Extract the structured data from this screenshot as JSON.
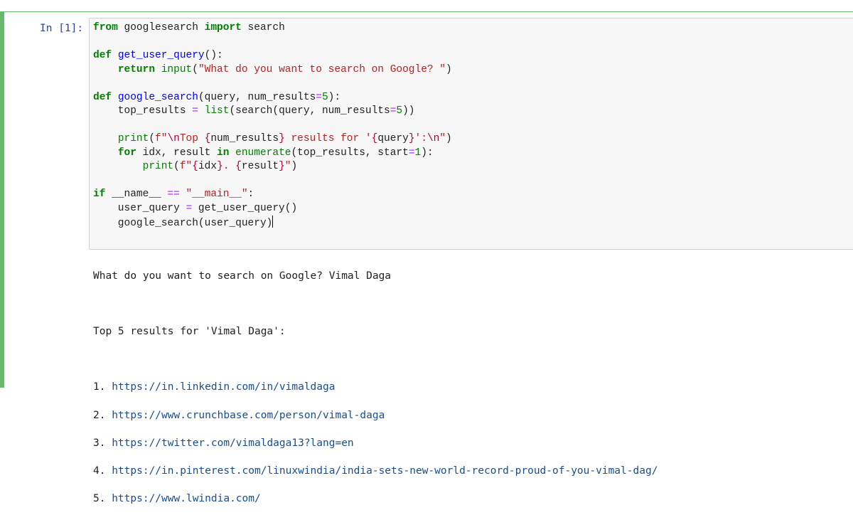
{
  "cell": {
    "prompt": "In [1]:",
    "code_lines": [
      "from googlesearch import search",
      "",
      "def get_user_query():",
      "    return input(\"What do you want to search on Google? \")",
      "",
      "def google_search(query, num_results=5):",
      "    top_results = list(search(query, num_results=5))",
      "",
      "    print(f\"\\nTop {num_results} results for '{query}':\\n\")",
      "    for idx, result in enumerate(top_results, start=1):",
      "        print(f\"{idx}. {result}\")",
      "",
      "if __name__ == \"__main__\":",
      "    user_query = get_user_query()",
      "    google_search(user_query)"
    ]
  },
  "output": {
    "input_echo": "What do you want to search on Google? Vimal Daga",
    "results_header": "Top 5 results for 'Vimal Daga':",
    "results": [
      {
        "index": "1.",
        "url": "https://in.linkedin.com/in/vimaldaga"
      },
      {
        "index": "2.",
        "url": "https://www.crunchbase.com/person/vimal-daga"
      },
      {
        "index": "3.",
        "url": "https://twitter.com/vimaldaga13?lang=en"
      },
      {
        "index": "4.",
        "url": "https://in.pinterest.com/linuxwindia/india-sets-new-world-record-proud-of-you-vimal-dag/"
      },
      {
        "index": "5.",
        "url": "https://www.lwindia.com/"
      }
    ]
  },
  "colors": {
    "selected_cell_bar": "#66bb6a",
    "prompt": "#303f9f",
    "keyword": "#008000",
    "function_name": "#0000ff",
    "string": "#ba2121",
    "url": "#1a4d8f"
  }
}
